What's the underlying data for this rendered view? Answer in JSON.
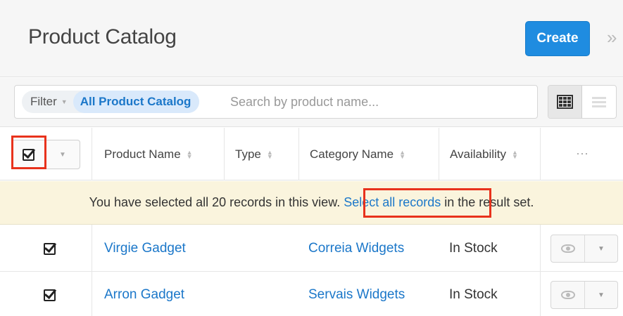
{
  "header": {
    "title": "Product Catalog",
    "create_label": "Create",
    "collapse_glyph": "»"
  },
  "filter": {
    "label": "Filter",
    "tag": "All Product Catalog",
    "search_placeholder": "Search by product name...",
    "views": [
      {
        "name": "grid-view-icon",
        "active": true
      },
      {
        "name": "list-view-icon",
        "active": false
      }
    ]
  },
  "table": {
    "columns": [
      "Product Name",
      "Type",
      "Category Name",
      "Availability"
    ],
    "more_glyph": "⋯",
    "select_all_checked": true
  },
  "notice": {
    "before": "You have selected all 20 records in this view. ",
    "link": "Select all records",
    "after": " in the result set."
  },
  "rows": [
    {
      "checked": true,
      "product": "Virgie Gadget",
      "type": "",
      "category": "Correia Widgets",
      "availability": "In Stock"
    },
    {
      "checked": true,
      "product": "Arron Gadget",
      "type": "",
      "category": "Servais Widgets",
      "availability": "In Stock"
    }
  ],
  "colors": {
    "accent": "#1f8ce0",
    "link": "#1b77c9",
    "highlight_box": "#e8321c",
    "notice_bg": "#faf4dd"
  }
}
